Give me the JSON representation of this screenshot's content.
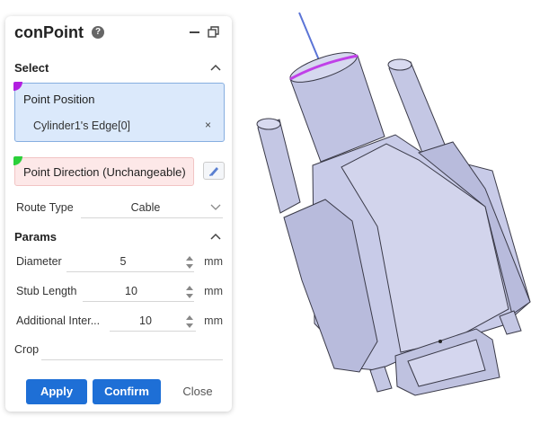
{
  "panel": {
    "title": "conPoint",
    "help_glyph": "?"
  },
  "select_section": {
    "header": "Select",
    "point_position": {
      "label": "Point Position",
      "items": [
        "Cylinder1's Edge[0]"
      ],
      "remove_glyph": "×",
      "accent": "#b21fe0"
    },
    "point_direction": {
      "label": "Point Direction (Unchangeable)",
      "accent": "#2bd03a"
    },
    "route_type": {
      "label": "Route Type",
      "value": "Cable"
    }
  },
  "params_section": {
    "header": "Params",
    "fields": [
      {
        "label": "Diameter",
        "value": "5",
        "unit": "mm"
      },
      {
        "label": "Stub Length",
        "value": "10",
        "unit": "mm"
      },
      {
        "label": "Additional Inter...",
        "value": "10",
        "unit": "mm"
      }
    ],
    "crop": {
      "label": "Crop",
      "value": ""
    }
  },
  "buttons": {
    "apply": "Apply",
    "confirm": "Confirm",
    "close": "Close"
  },
  "colors": {
    "primary": "#1e6fd6",
    "selection_bg": "#dbe9fb",
    "direction_bg": "#fde8e8",
    "model_body": "#c8cbe8",
    "model_edge": "#3a3a48",
    "highlight_edge": "#c040e8",
    "direction_line": "#5b74d6"
  }
}
